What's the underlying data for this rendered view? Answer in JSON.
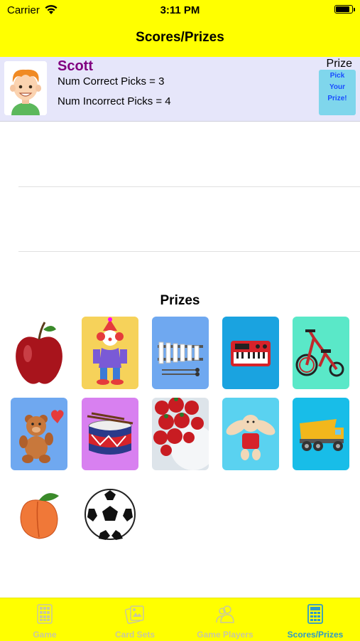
{
  "status": {
    "carrier": "Carrier",
    "time": "3:11 PM"
  },
  "nav": {
    "title": "Scores/Prizes"
  },
  "player": {
    "name": "Scott",
    "correct_text": "Num Correct Picks = 3",
    "incorrect_text": "Num Incorrect Picks = 4",
    "prize_label": "Prize",
    "prize_button": [
      "Pick",
      "Your",
      "Prize!"
    ]
  },
  "prizes": {
    "title": "Prizes",
    "items": [
      "apple",
      "clown",
      "xylophone",
      "toy-piano",
      "tricycle",
      "teddy-bear",
      "drum",
      "strawberries",
      "bunny",
      "dump-truck",
      "peach",
      "soccer-ball"
    ]
  },
  "tabs": [
    {
      "label": "Game",
      "icon": "game-icon",
      "active": false
    },
    {
      "label": "Card Sets",
      "icon": "card-sets-icon",
      "active": false
    },
    {
      "label": "Game Players",
      "icon": "players-icon",
      "active": false
    },
    {
      "label": "Scores/Prizes",
      "icon": "calculator-icon",
      "active": true
    }
  ],
  "colors": {
    "bars": "#ffff00",
    "player_row": "#e6e6fa",
    "name": "#800080",
    "active_tab": "#2e9ac8"
  }
}
